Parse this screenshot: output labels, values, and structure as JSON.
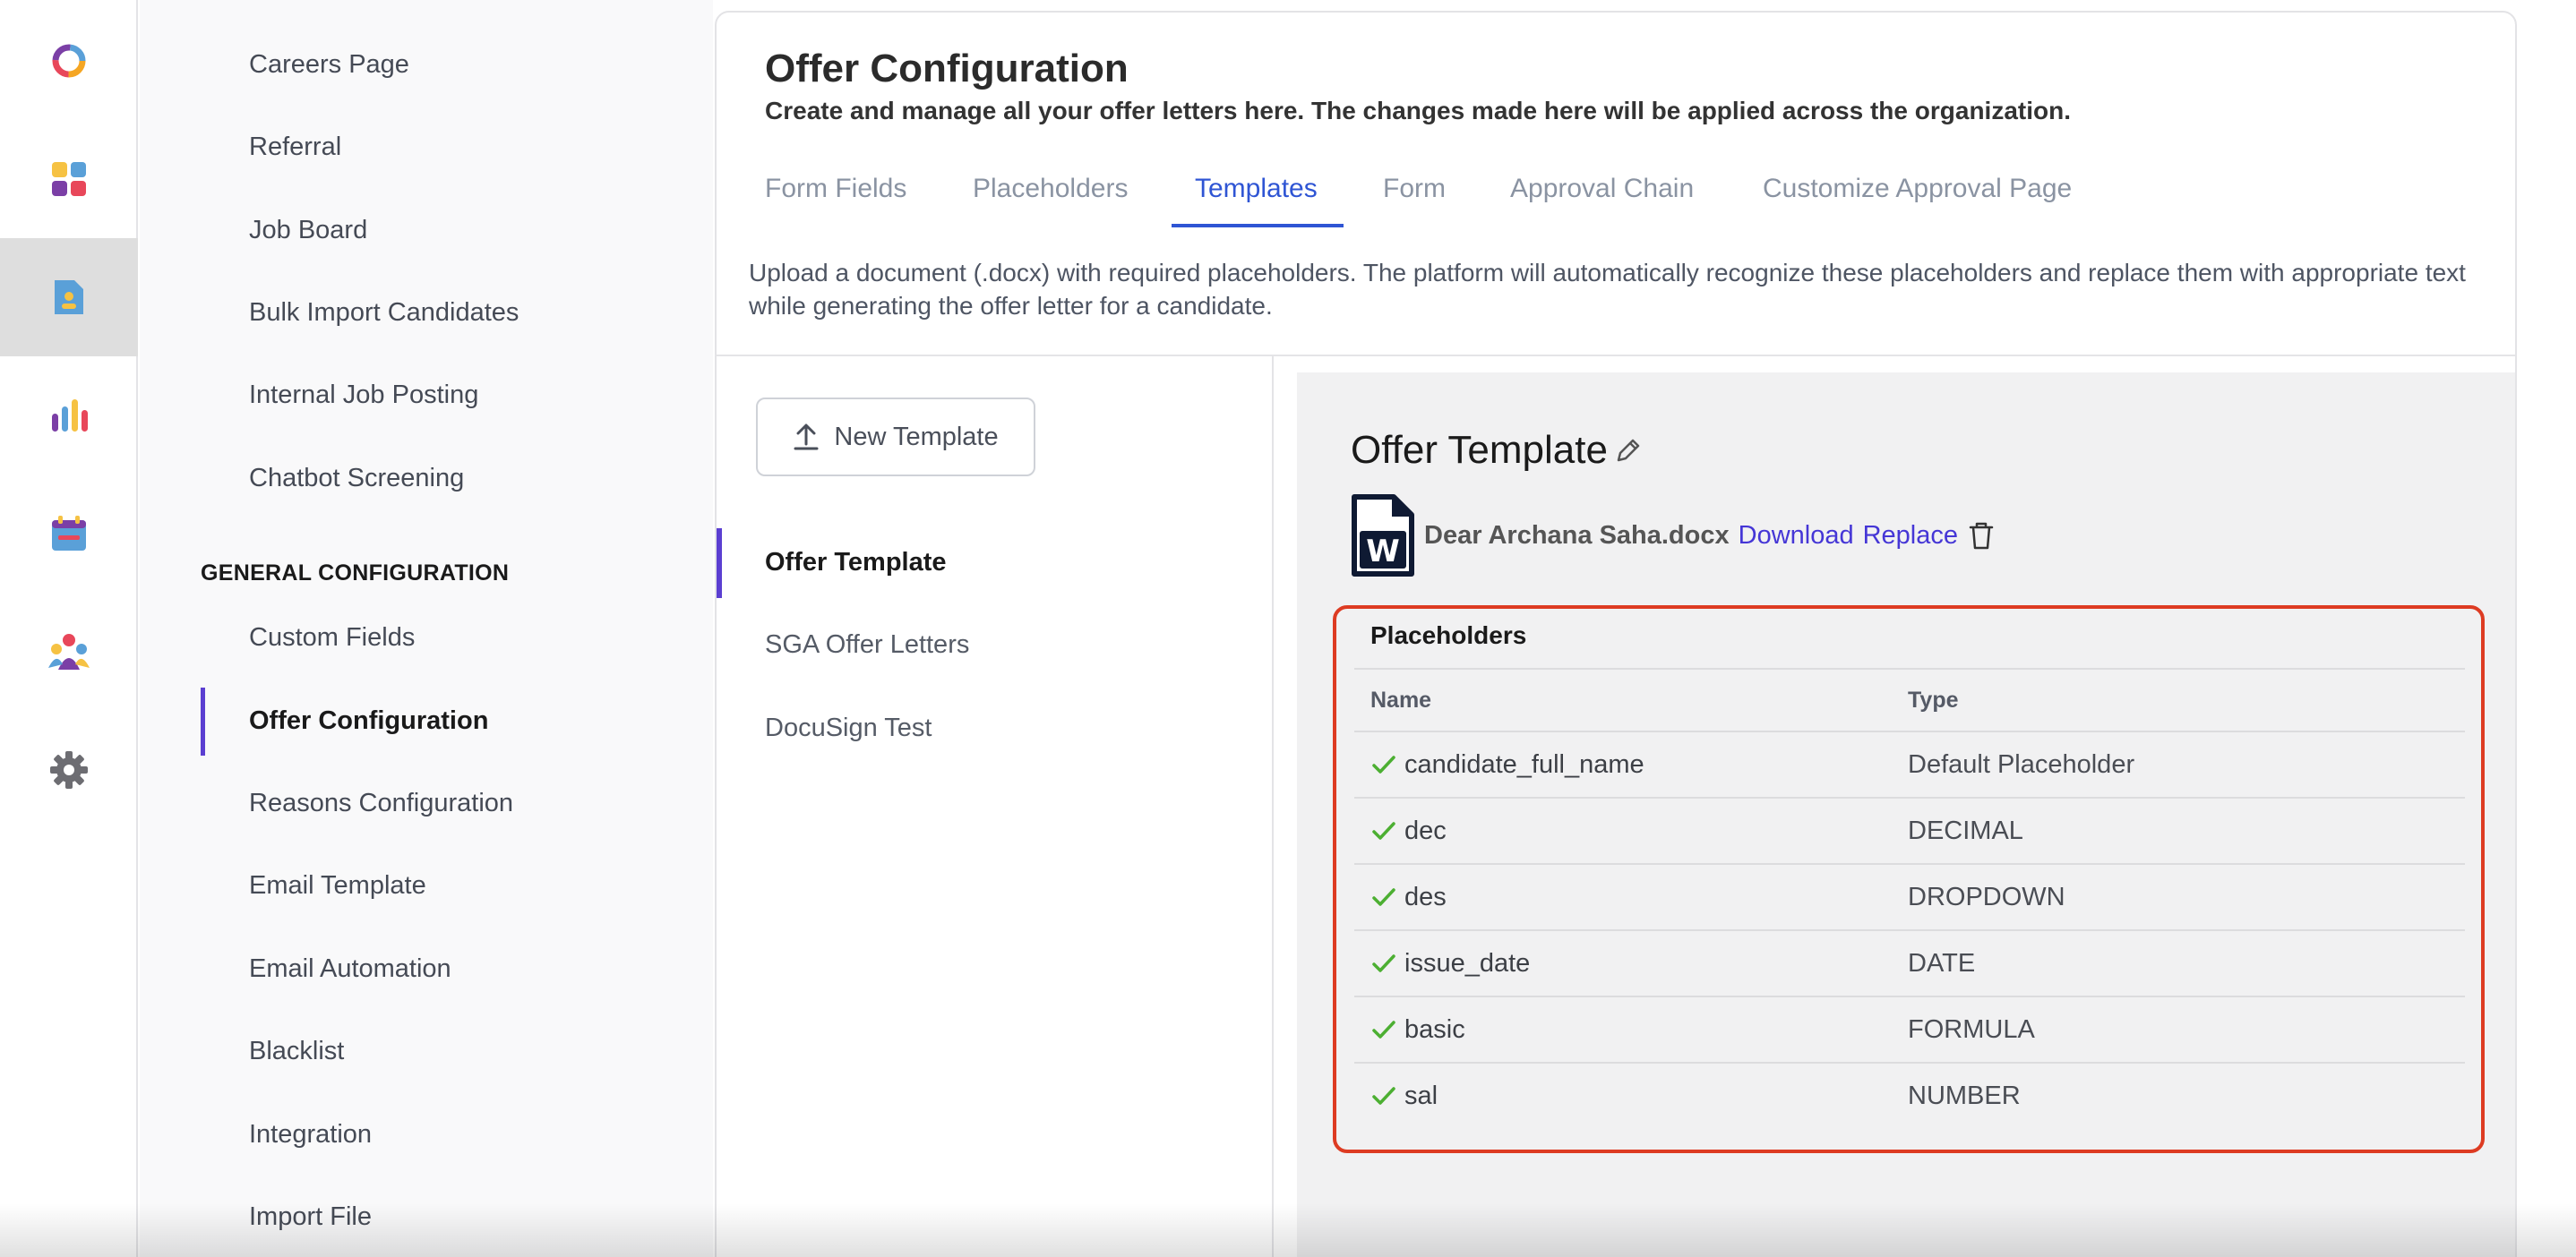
{
  "rail": {
    "icons": [
      "logo-ring-icon",
      "apps-grid-icon",
      "candidate-profile-icon",
      "reports-bar-chart-icon",
      "calendar-icon",
      "team-people-icon",
      "settings-gear-icon"
    ]
  },
  "sidebar": {
    "items_top": [
      {
        "label": "Careers Page"
      },
      {
        "label": "Referral"
      },
      {
        "label": "Job Board"
      },
      {
        "label": "Bulk Import Candidates"
      },
      {
        "label": "Internal Job Posting"
      },
      {
        "label": "Chatbot Screening"
      }
    ],
    "section_heading": "GENERAL CONFIGURATION",
    "items_general": [
      {
        "label": "Custom Fields"
      },
      {
        "label": "Offer Configuration"
      },
      {
        "label": "Reasons Configuration"
      },
      {
        "label": "Email Template"
      },
      {
        "label": "Email Automation"
      },
      {
        "label": "Blacklist"
      },
      {
        "label": "Integration"
      },
      {
        "label": "Import File"
      }
    ],
    "active_item": "Offer Configuration"
  },
  "header": {
    "title": "Offer Configuration",
    "subtitle": "Create and manage all your offer letters here. The changes made here will be applied across the organization."
  },
  "tabs": [
    {
      "label": "Form Fields"
    },
    {
      "label": "Placeholders"
    },
    {
      "label": "Templates"
    },
    {
      "label": "Form"
    },
    {
      "label": "Approval Chain"
    },
    {
      "label": "Customize Approval Page"
    }
  ],
  "active_tab": "Templates",
  "description": "Upload a document (.docx) with required placeholders. The platform will automatically recognize these placeholders and replace them with appropriate text while generating the offer letter for a candidate.",
  "templates": {
    "new_button_label": "New Template",
    "list": [
      {
        "label": "Offer Template"
      },
      {
        "label": "SGA Offer Letters"
      },
      {
        "label": "DocuSign Test"
      }
    ],
    "active": "Offer Template"
  },
  "detail": {
    "title": "Offer Template",
    "file_name": "Dear Archana Saha.docx",
    "download_label": "Download",
    "replace_label": "Replace",
    "placeholders": {
      "title": "Placeholders",
      "columns": {
        "name": "Name",
        "type": "Type"
      },
      "rows": [
        {
          "name": "candidate_full_name",
          "type": "Default Placeholder"
        },
        {
          "name": "dec",
          "type": "DECIMAL"
        },
        {
          "name": "des",
          "type": "DROPDOWN"
        },
        {
          "name": "issue_date",
          "type": "DATE"
        },
        {
          "name": "basic",
          "type": "FORMULA"
        },
        {
          "name": "sal",
          "type": "NUMBER"
        }
      ]
    }
  },
  "colors": {
    "accent_purple": "#5b3fd1",
    "tab_active_blue": "#2f55d4",
    "link_blue": "#4536d6",
    "highlight_red": "#dd3b22",
    "check_green": "#4caf32"
  }
}
